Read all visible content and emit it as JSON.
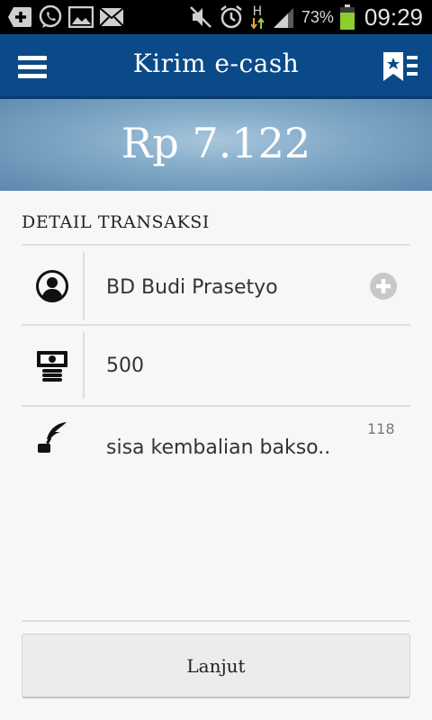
{
  "status_bar": {
    "icons": [
      "add-box-icon",
      "whatsapp-icon",
      "gallery-icon",
      "mail-icon",
      "mute-icon",
      "alarm-icon",
      "data-h-icon",
      "signal-icon",
      "battery-icon"
    ],
    "network_type": "H",
    "battery": "73%",
    "time": "09:29"
  },
  "app_bar": {
    "title": "Kirim e-cash",
    "menu_icon": "hamburger-menu-icon",
    "bookmark_icon": "bookmark-list-icon"
  },
  "balance": {
    "amount": "Rp 7.122"
  },
  "transaction": {
    "section_title": "DETAIL TRANSAKSI",
    "recipient": {
      "icon": "user-icon",
      "value": "BD Budi Prasetyo",
      "action_icon": "add-circle-icon"
    },
    "amount": {
      "icon": "money-icon",
      "value": "500"
    },
    "note": {
      "icon": "quill-pen-icon",
      "value": "sisa kembalian bakso..",
      "remaining_chars": "118"
    }
  },
  "actions": {
    "next_label": "Lanjut"
  },
  "colors": {
    "app_bar": "#0b4a88",
    "banner": "#7fa7c6",
    "background": "#f7f7f7",
    "divider": "#dedede",
    "button": "#ececec"
  }
}
